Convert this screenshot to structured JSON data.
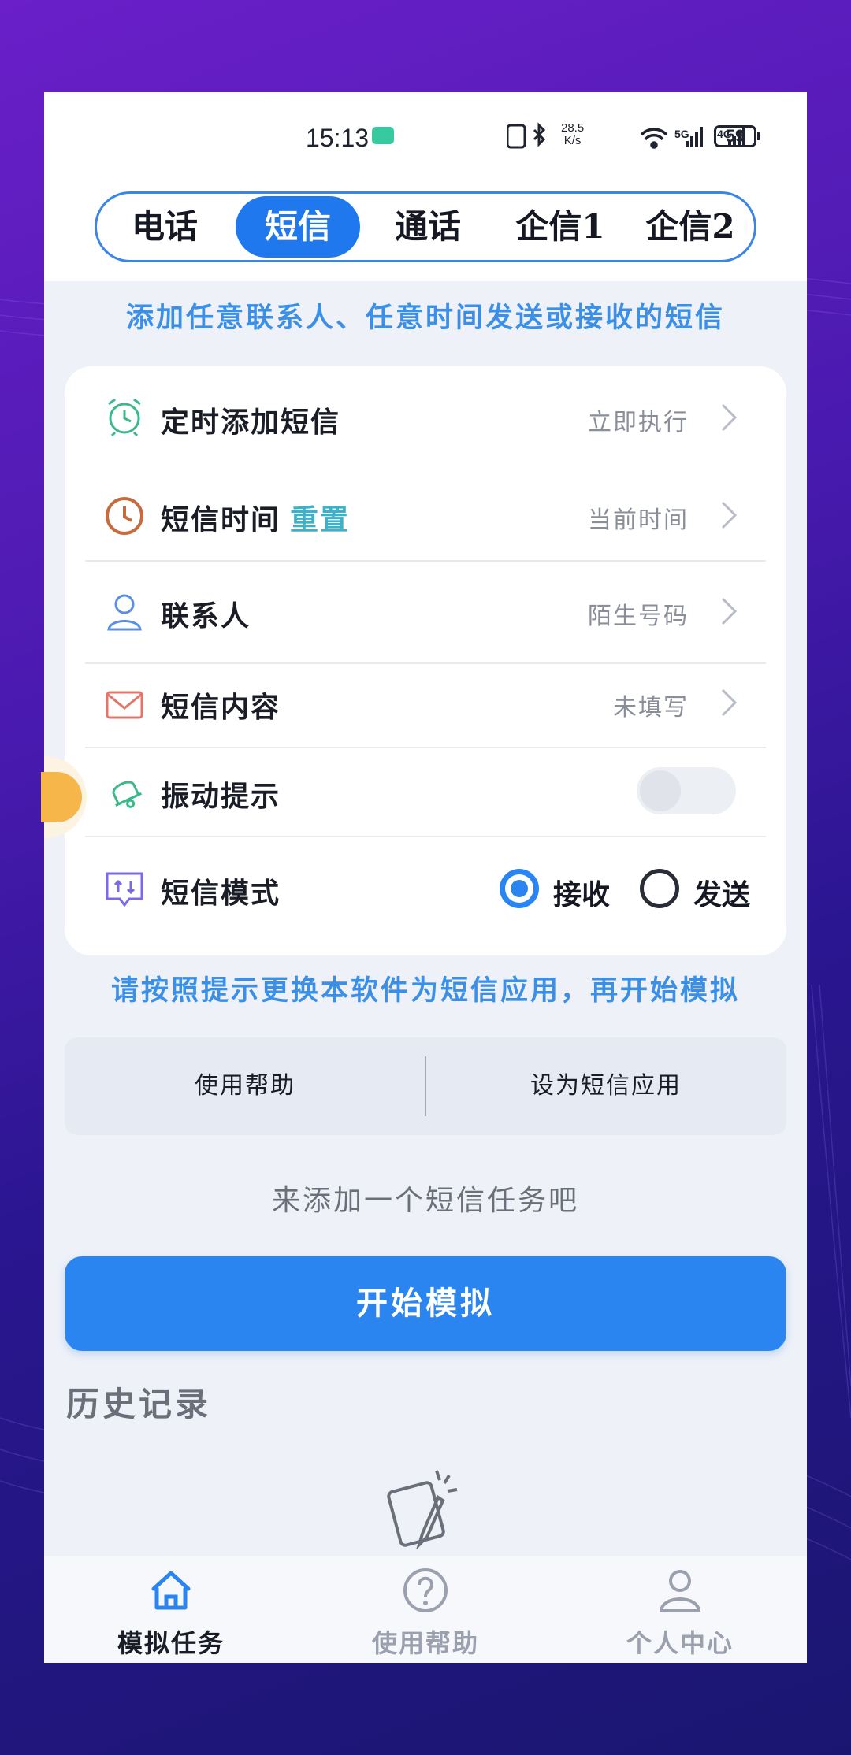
{
  "status_bar": {
    "time": "15:13",
    "speed_value": "28.5",
    "speed_unit": "K/s",
    "battery": "59"
  },
  "tabs": [
    {
      "label": "电话",
      "active": false
    },
    {
      "label": "短信",
      "active": true
    },
    {
      "label": "通话",
      "active": false
    },
    {
      "label": "企信1",
      "active": false
    },
    {
      "label": "企信2",
      "active": false
    }
  ],
  "hint_top": "添加任意联系人、任意时间发送或接收的短信",
  "settings": {
    "scheduled_add": {
      "label": "定时添加短信",
      "value": "立即执行",
      "icon": "alarm-clock-icon"
    },
    "sms_time": {
      "label": "短信时间",
      "reset": "重置",
      "value": "当前时间",
      "icon": "clock-icon"
    },
    "contact": {
      "label": "联系人",
      "value": "陌生号码",
      "icon": "person-icon"
    },
    "content": {
      "label": "短信内容",
      "value": "未填写",
      "icon": "envelope-icon"
    },
    "vibrate": {
      "label": "振动提示",
      "enabled": false,
      "icon": "bell-icon"
    },
    "mode": {
      "label": "短信模式",
      "options": [
        "接收",
        "发送"
      ],
      "selected": "接收",
      "icon": "message-transfer-icon"
    }
  },
  "hint_mid": "请按照提示更换本软件为短信应用，再开始模拟",
  "buttons": {
    "help": "使用帮助",
    "set_default": "设为短信应用",
    "start": "开始模拟"
  },
  "empty_tip": "来添加一个短信任务吧",
  "history_title": "历史记录",
  "bottom_nav": [
    {
      "label": "模拟任务",
      "icon": "home-icon",
      "active": true
    },
    {
      "label": "使用帮助",
      "icon": "question-icon",
      "active": false
    },
    {
      "label": "个人中心",
      "icon": "user-icon",
      "active": false
    }
  ],
  "colors": {
    "accent": "#1f78ee",
    "hint": "#3b8fe6",
    "reset": "#3fb0c8",
    "inactive_nav": "#9aa0ad"
  }
}
